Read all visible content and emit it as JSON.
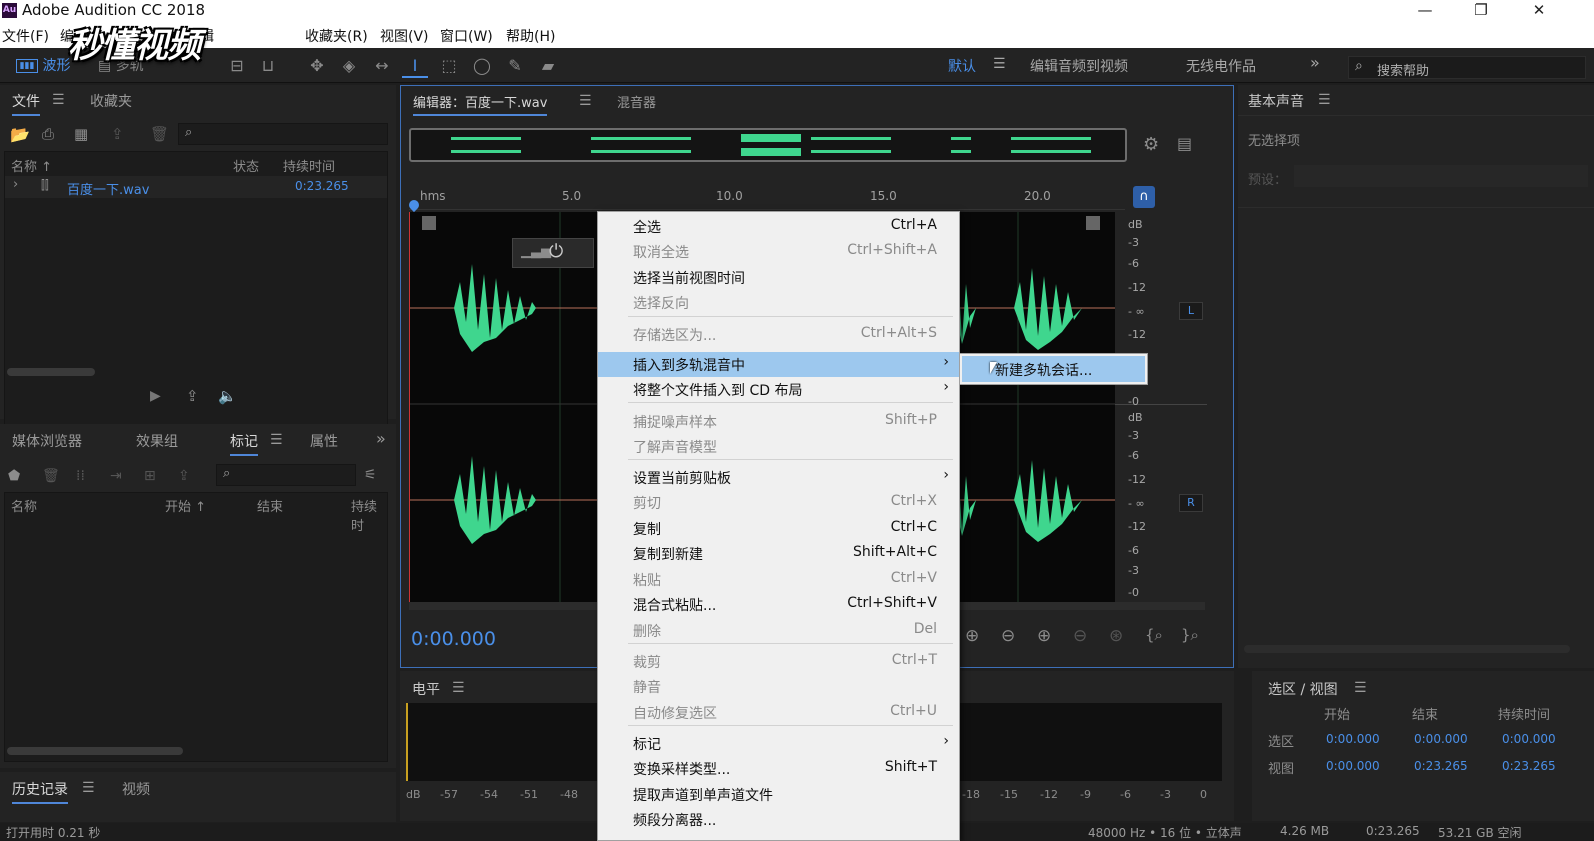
{
  "app": {
    "logo": "Au",
    "title": "Adobe Audition CC 2018",
    "window_controls": [
      "—",
      "❐",
      "✕"
    ]
  },
  "watermark": "秒懂视频",
  "menu": [
    "文件(F)",
    "编",
    "剪辑",
    "收藏夹(R)",
    "视图(V)",
    "窗口(W)",
    "帮助(H)"
  ],
  "toolbar": {
    "waveform_label": "波形",
    "multitrack_label": "多轨",
    "workspaces": [
      "默认",
      "编辑音频到视频",
      "无线电作品"
    ],
    "more": "»",
    "help_placeholder": "搜索帮助"
  },
  "files_panel": {
    "tabs": [
      "文件",
      "收藏夹"
    ],
    "columns": [
      "名称 ↑",
      "状态",
      "持续时间"
    ],
    "rows": [
      {
        "name": "百度一下.wav",
        "duration": "0:23.265"
      }
    ]
  },
  "bottom_left_panel": {
    "tabs": [
      "媒体浏览器",
      "效果组",
      "标记",
      "属性"
    ],
    "more": "»",
    "columns": [
      "名称",
      "开始 ↑",
      "结束",
      "持续时"
    ]
  },
  "history_panel": {
    "tabs": [
      "历史记录",
      "视频"
    ]
  },
  "editor": {
    "tab": "编辑器：百度一下.wav",
    "mixer_tab": "混音器",
    "ruler": [
      "hms",
      "5.0",
      "10.0",
      "15.0",
      "20.0"
    ],
    "db_top": [
      "dB",
      "-3",
      "-6",
      "-12",
      "- ∞",
      "-12",
      "-6",
      "-3",
      "-0"
    ],
    "db_bottom": [
      "dB",
      "-3",
      "-6",
      "-12",
      "- ∞",
      "-12",
      "-6",
      "-3",
      "-0"
    ],
    "channels": [
      "L",
      "R"
    ],
    "time": "0:00.000"
  },
  "levels_panel": {
    "title": "电平",
    "scale_left": [
      "dB",
      "-57",
      "-54",
      "-51",
      "-48"
    ],
    "scale_right": [
      "-18",
      "-15",
      "-12",
      "-9",
      "-6",
      "-3",
      "0"
    ]
  },
  "essential_sound": {
    "title": "基本声音",
    "no_selection": "无选择项",
    "preset_label": "预设："
  },
  "selection_view": {
    "title": "选区 / 视图",
    "columns": [
      "开始",
      "结束",
      "持续时间"
    ],
    "rows": [
      {
        "label": "选区",
        "start": "0:00.000",
        "end": "0:00.000",
        "duration": "0:00.000"
      },
      {
        "label": "视图",
        "start": "0:00.000",
        "end": "0:23.265",
        "duration": "0:23.265"
      }
    ]
  },
  "context_menu": [
    {
      "label": "全选",
      "shortcut": "Ctrl+A",
      "disabled": false
    },
    {
      "label": "取消全选",
      "shortcut": "Ctrl+Shift+A",
      "disabled": true
    },
    {
      "label": "选择当前视图时间",
      "shortcut": "",
      "disabled": false
    },
    {
      "label": "选择反向",
      "shortcut": "",
      "disabled": true
    },
    {
      "label": "存储选区为...",
      "shortcut": "Ctrl+Alt+S",
      "disabled": true
    },
    {
      "label": "插入到多轨混音中",
      "shortcut": "",
      "disabled": false
    },
    {
      "label": "将整个文件插入到 CD 布局",
      "shortcut": "",
      "disabled": false
    },
    {
      "label": "捕捉噪声样本",
      "shortcut": "Shift+P",
      "disabled": true
    },
    {
      "label": "了解声音模型",
      "shortcut": "",
      "disabled": true
    },
    {
      "label": "设置当前剪贴板",
      "shortcut": "",
      "disabled": false
    },
    {
      "label": "剪切",
      "shortcut": "Ctrl+X",
      "disabled": true
    },
    {
      "label": "复制",
      "shortcut": "Ctrl+C",
      "disabled": false
    },
    {
      "label": "复制到新建",
      "shortcut": "Shift+Alt+C",
      "disabled": false
    },
    {
      "label": "粘贴",
      "shortcut": "Ctrl+V",
      "disabled": true
    },
    {
      "label": "混合式粘贴...",
      "shortcut": "Ctrl+Shift+V",
      "disabled": false
    },
    {
      "label": "删除",
      "shortcut": "Del",
      "disabled": true
    },
    {
      "label": "裁剪",
      "shortcut": "Ctrl+T",
      "disabled": true
    },
    {
      "label": "静音",
      "shortcut": "",
      "disabled": true
    },
    {
      "label": "自动修复选区",
      "shortcut": "Ctrl+U",
      "disabled": true
    },
    {
      "label": "标记",
      "shortcut": "",
      "disabled": false
    },
    {
      "label": "变换采样类型...",
      "shortcut": "Shift+T",
      "disabled": false
    },
    {
      "label": "提取声道到单声道文件",
      "shortcut": "",
      "disabled": false
    },
    {
      "label": "频段分离器...",
      "shortcut": "",
      "disabled": false
    }
  ],
  "submenu_item": "新建多轨会话...",
  "status": {
    "left": "打开用时 0.21 秒",
    "sample": "48000 Hz • 16 位 • 立体声",
    "size": "4.26 MB",
    "duration": "0:23.265",
    "free": "53.21 GB 空闲"
  },
  "colors": {
    "waveform": "#3fd68e",
    "accent": "#4a8fe8",
    "menu_highlight": "#9dc8ee"
  }
}
